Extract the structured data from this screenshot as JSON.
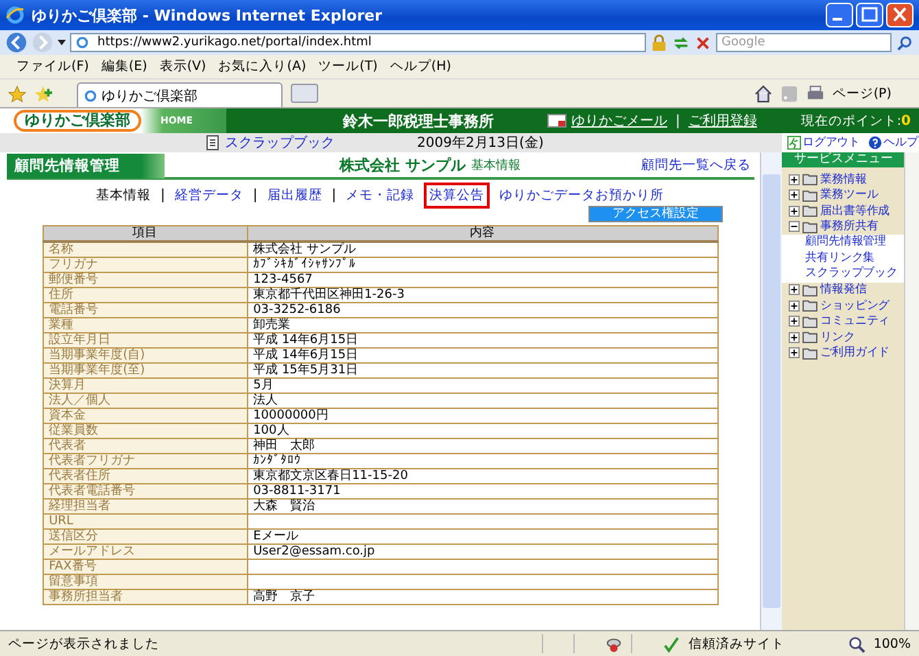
{
  "window": {
    "title": "ゆりかご倶楽部 - Windows Internet Explorer"
  },
  "address_bar": {
    "url": "https://www2.yurikago.net/portal/index.html"
  },
  "search": {
    "placeholder": "Google"
  },
  "menu": [
    "ファイル(F)",
    "編集(E)",
    "表示(V)",
    "お気に入り(A)",
    "ツール(T)",
    "ヘルプ(H)"
  ],
  "tabs": [
    {
      "label": "ゆりかご倶楽部",
      "selected": true
    }
  ],
  "toolbar": {
    "page_menu": "ページ(P)"
  },
  "site": {
    "logo": "ゆりかご倶楽部",
    "home": "HOME",
    "office": "鈴木一郎税理士事務所",
    "links": [
      "ゆりかごメール",
      "ご利用登録"
    ],
    "link_separator": "|",
    "points_label": "現在のポイント:",
    "points": "0",
    "scrapbook": "スクラップブック",
    "date": "2009年2月13日(金)",
    "logout": "ログアウト",
    "help": "ヘルプ"
  },
  "section": {
    "title": "顧問先情報管理",
    "company": "株式会社 サンプル",
    "subtitle": "基本情報",
    "back_link": "顧問先一覧へ戻る"
  },
  "subnav": [
    {
      "label": "基本情報",
      "current": true,
      "highlighted": false,
      "sep": "|"
    },
    {
      "label": "経営データ",
      "current": false,
      "highlighted": false,
      "sep": "|"
    },
    {
      "label": "届出履歴",
      "current": false,
      "highlighted": false,
      "sep": "|"
    },
    {
      "label": "メモ・記録",
      "current": false,
      "highlighted": false
    },
    {
      "label": "決算公告",
      "current": false,
      "highlighted": true
    },
    {
      "label": "ゆりかごデータお預かり所",
      "current": false,
      "highlighted": false
    }
  ],
  "access_button": "アクセス権設定",
  "table": {
    "columns": [
      "項目",
      "内容"
    ],
    "rows": [
      {
        "item": "名称",
        "value": "株式会社 サンプル"
      },
      {
        "item": "フリガナ",
        "value": "ｶﾌﾞｼｷｶﾞｲｼｬｻﾝﾌﾟﾙ"
      },
      {
        "item": "郵便番号",
        "value": "123-4567"
      },
      {
        "item": "住所",
        "value": "東京都千代田区神田1-26-3"
      },
      {
        "item": "電話番号",
        "value": "03-3252-6186"
      },
      {
        "item": "業種",
        "value": "卸売業"
      },
      {
        "item": "設立年月日",
        "value": "平成 14年6月15日"
      },
      {
        "item": "当期事業年度(自)",
        "value": "平成 14年6月15日"
      },
      {
        "item": "当期事業年度(至)",
        "value": "平成 15年5月31日"
      },
      {
        "item": "決算月",
        "value": "5月"
      },
      {
        "item": "法人／個人",
        "value": "法人"
      },
      {
        "item": "資本金",
        "value": "10000000円"
      },
      {
        "item": "従業員数",
        "value": "100人"
      },
      {
        "item": "代表者",
        "value": "神田　太郎"
      },
      {
        "item": "代表者フリガナ",
        "value": "ｶﾝﾀﾞﾀﾛｳ"
      },
      {
        "item": "代表者住所",
        "value": "東京都文京区春日11-15-20"
      },
      {
        "item": "代表者電話番号",
        "value": "03-8811-3171"
      },
      {
        "item": "経理担当者",
        "value": "大森　賢治"
      },
      {
        "item": "URL"
      },
      {
        "item": "送信区分",
        "value": "Eメール"
      },
      {
        "item": "メールアドレス",
        "value": "User2@essam.co.jp"
      },
      {
        "item": "FAX番号"
      },
      {
        "item": "留意事項"
      },
      {
        "item": "事務所担当者",
        "value": "高野　京子"
      }
    ]
  },
  "sidebar": {
    "title": "サービスメニュー",
    "items": [
      {
        "label": "業務情報",
        "expanded": false
      },
      {
        "label": "業務ツール",
        "expanded": false
      },
      {
        "label": "届出書等作成",
        "expanded": false
      },
      {
        "label": "事務所共有",
        "expanded": true,
        "children": [
          {
            "label": "顧問先情報管理"
          },
          {
            "label": "共有リンク集"
          },
          {
            "label": "スクラップブック"
          }
        ]
      },
      {
        "label": "情報発信",
        "expanded": false
      },
      {
        "label": "ショッピング",
        "expanded": false
      },
      {
        "label": "コミュニティ",
        "expanded": false
      },
      {
        "label": "リンク",
        "expanded": false
      },
      {
        "label": "ご利用ガイド",
        "expanded": false
      }
    ]
  },
  "status_bar": {
    "message": "ページが表示されました",
    "zone": "信頼済みサイト",
    "zoom": "100%"
  }
}
